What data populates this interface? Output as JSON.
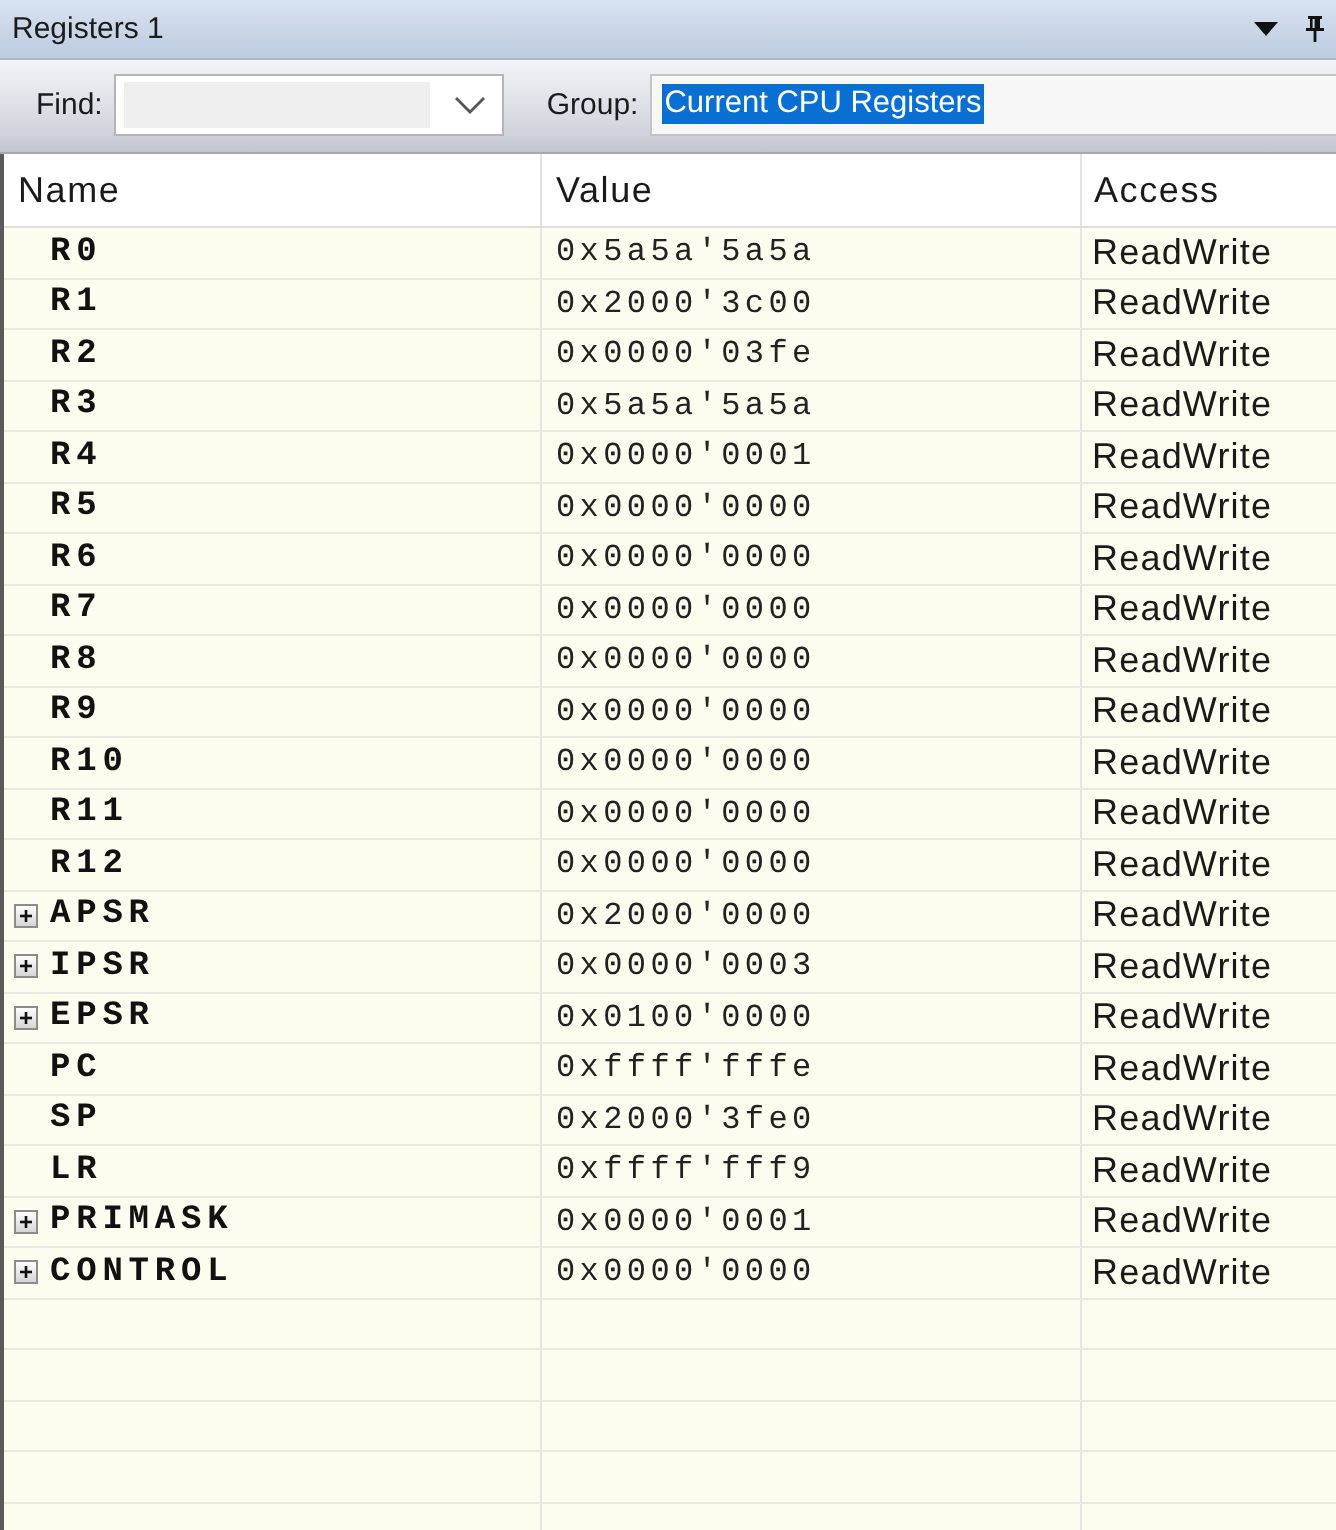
{
  "window": {
    "title": "Registers 1"
  },
  "toolbar": {
    "find": {
      "label": "Find:"
    },
    "group": {
      "label": "Group:",
      "value": "Current CPU Registers",
      "text_selected": true
    }
  },
  "table": {
    "columns": [
      "Name",
      "Value",
      "Access"
    ],
    "rows": [
      {
        "kind": "register",
        "name": "R0",
        "value": "0x5a5a'5a5a",
        "access": "ReadWrite"
      },
      {
        "kind": "register",
        "name": "R1",
        "value": "0x2000'3c00",
        "access": "ReadWrite"
      },
      {
        "kind": "register",
        "name": "R2",
        "value": "0x0000'03fe",
        "access": "ReadWrite"
      },
      {
        "kind": "register",
        "name": "R3",
        "value": "0x5a5a'5a5a",
        "access": "ReadWrite"
      },
      {
        "kind": "register",
        "name": "R4",
        "value": "0x0000'0001",
        "access": "ReadWrite"
      },
      {
        "kind": "register",
        "name": "R5",
        "value": "0x0000'0000",
        "access": "ReadWrite"
      },
      {
        "kind": "register",
        "name": "R6",
        "value": "0x0000'0000",
        "access": "ReadWrite"
      },
      {
        "kind": "register",
        "name": "R7",
        "value": "0x0000'0000",
        "access": "ReadWrite"
      },
      {
        "kind": "register",
        "name": "R8",
        "value": "0x0000'0000",
        "access": "ReadWrite"
      },
      {
        "kind": "register",
        "name": "R9",
        "value": "0x0000'0000",
        "access": "ReadWrite"
      },
      {
        "kind": "register",
        "name": "R10",
        "value": "0x0000'0000",
        "access": "ReadWrite"
      },
      {
        "kind": "register",
        "name": "R11",
        "value": "0x0000'0000",
        "access": "ReadWrite"
      },
      {
        "kind": "register",
        "name": "R12",
        "value": "0x0000'0000",
        "access": "ReadWrite"
      },
      {
        "kind": "group",
        "expanded": false,
        "name": "APSR",
        "value": "0x2000'0000",
        "access": "ReadWrite"
      },
      {
        "kind": "group",
        "expanded": false,
        "name": "IPSR",
        "value": "0x0000'0003",
        "access": "ReadWrite"
      },
      {
        "kind": "group",
        "expanded": false,
        "name": "EPSR",
        "value": "0x0100'0000",
        "access": "ReadWrite"
      },
      {
        "kind": "register",
        "name": "PC",
        "value": "0xffff'fffe",
        "access": "ReadWrite"
      },
      {
        "kind": "register",
        "name": "SP",
        "value": "0x2000'3fe0",
        "access": "ReadWrite"
      },
      {
        "kind": "register",
        "name": "LR",
        "value": "0xffff'fff9",
        "access": "ReadWrite"
      },
      {
        "kind": "group",
        "expanded": false,
        "name": "PRIMASK",
        "value": "0x0000'0001",
        "access": "ReadWrite"
      },
      {
        "kind": "group",
        "expanded": false,
        "name": "CONTROL",
        "value": "0x0000'0000",
        "access": "ReadWrite"
      }
    ]
  }
}
